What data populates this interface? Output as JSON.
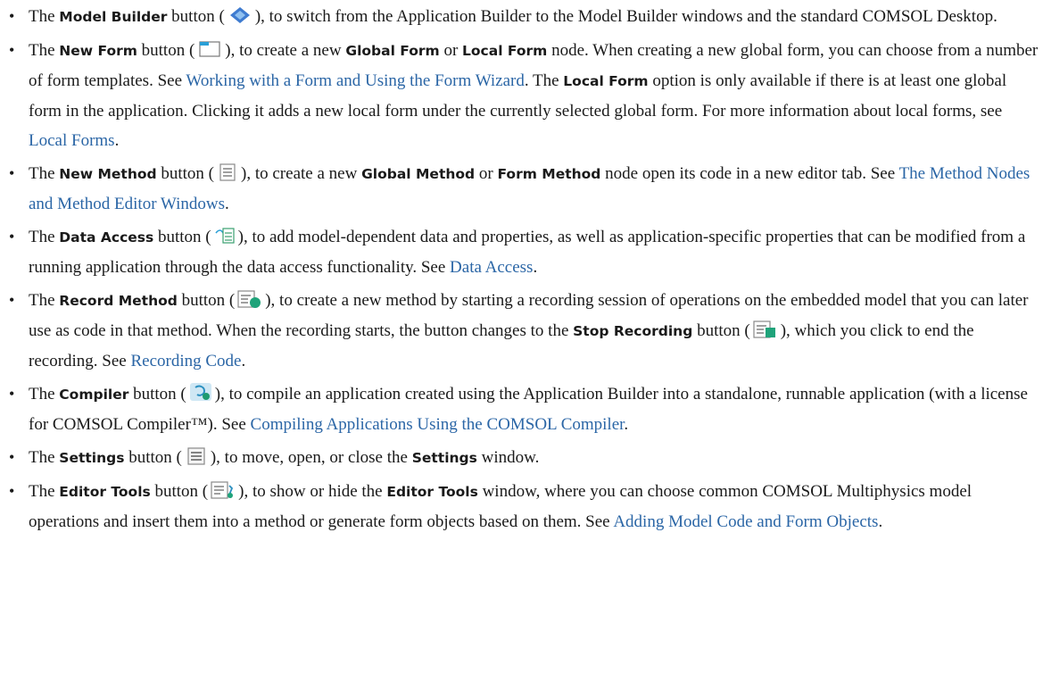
{
  "items": [
    {
      "t1": "The ",
      "bold": "Model Builder",
      "t2": " button (",
      "t3": "), to switch from the Application Builder to the Model Builder windows and the standard COMSOL Desktop.",
      "icon": "model-builder-icon"
    },
    {
      "t1": "The ",
      "bold": "New Form",
      "t2": " button (",
      "t3": "), to create a new ",
      "b2": "Global Form",
      "t4": " or ",
      "b3": "Local Form",
      "t5": " node. When creating a new global form, you can choose from a number of form templates. See ",
      "link1": "Working with a Form and Using the Form Wizard",
      "t6": ". The ",
      "b4": "Local Form",
      "t7": " option is only available if there is at least one global form in the application. Clicking it adds a new local form under the currently selected global form. For more information about local forms, see ",
      "link2": "Local Forms",
      "t8": ".",
      "icon": "new-form-icon"
    },
    {
      "t1": "The ",
      "bold": "New Method",
      "t2": " button (",
      "t3": "), to create a new ",
      "b2": "Global Method",
      "t4": " or ",
      "b3": "Form Method",
      "t5": " node open its code in a new editor tab. See ",
      "link1": "The Method Nodes and Method Editor Windows",
      "t6": ".",
      "icon": "new-method-icon"
    },
    {
      "t1": "The ",
      "bold": "Data Access",
      "t2": " button (",
      "t3": "), to add model-dependent data and properties, as well as application-specific properties that can be modified from a running application through the data access functionality. See ",
      "link1": "Data Access",
      "t4": ".",
      "icon": "data-access-icon"
    },
    {
      "t1": "The ",
      "bold": "Record Method",
      "t2": " button (",
      "t3": "), to create a new method by starting a recording session of operations on the embedded model that you can later use as code in that method. When the recording starts, the button changes to the ",
      "b2": "Stop Recording",
      "t4": " button (",
      "t5": "), which you click to end the recording. See ",
      "link1": "Recording Code",
      "t6": ".",
      "icon": "record-method-icon",
      "icon2": "stop-recording-icon"
    },
    {
      "t1": "The ",
      "bold": "Compiler",
      "t2": " button (",
      "t3": "), to compile an application created using the Application Builder into a standalone, runnable application (with a license for COMSOL Compiler™). See ",
      "link1": "Compiling Applications Using the COMSOL Compiler",
      "t4": ".",
      "icon": "compiler-icon"
    },
    {
      "t1": "The ",
      "bold": "Settings",
      "t2": " button (",
      "t3": "), to move, open, or close the ",
      "b2": "Settings",
      "t4": " window.",
      "icon": "settings-icon"
    },
    {
      "t1": "The ",
      "bold": "Editor Tools",
      "t2": " button (",
      "t3": "), to show or hide the ",
      "b2": "Editor Tools",
      "t4": " window, where you can choose common COMSOL Multiphysics model operations and insert them into a method or generate form objects based on them. See ",
      "link1": "Adding Model Code and Form Objects",
      "t5": ".",
      "icon": "editor-tools-icon"
    }
  ]
}
